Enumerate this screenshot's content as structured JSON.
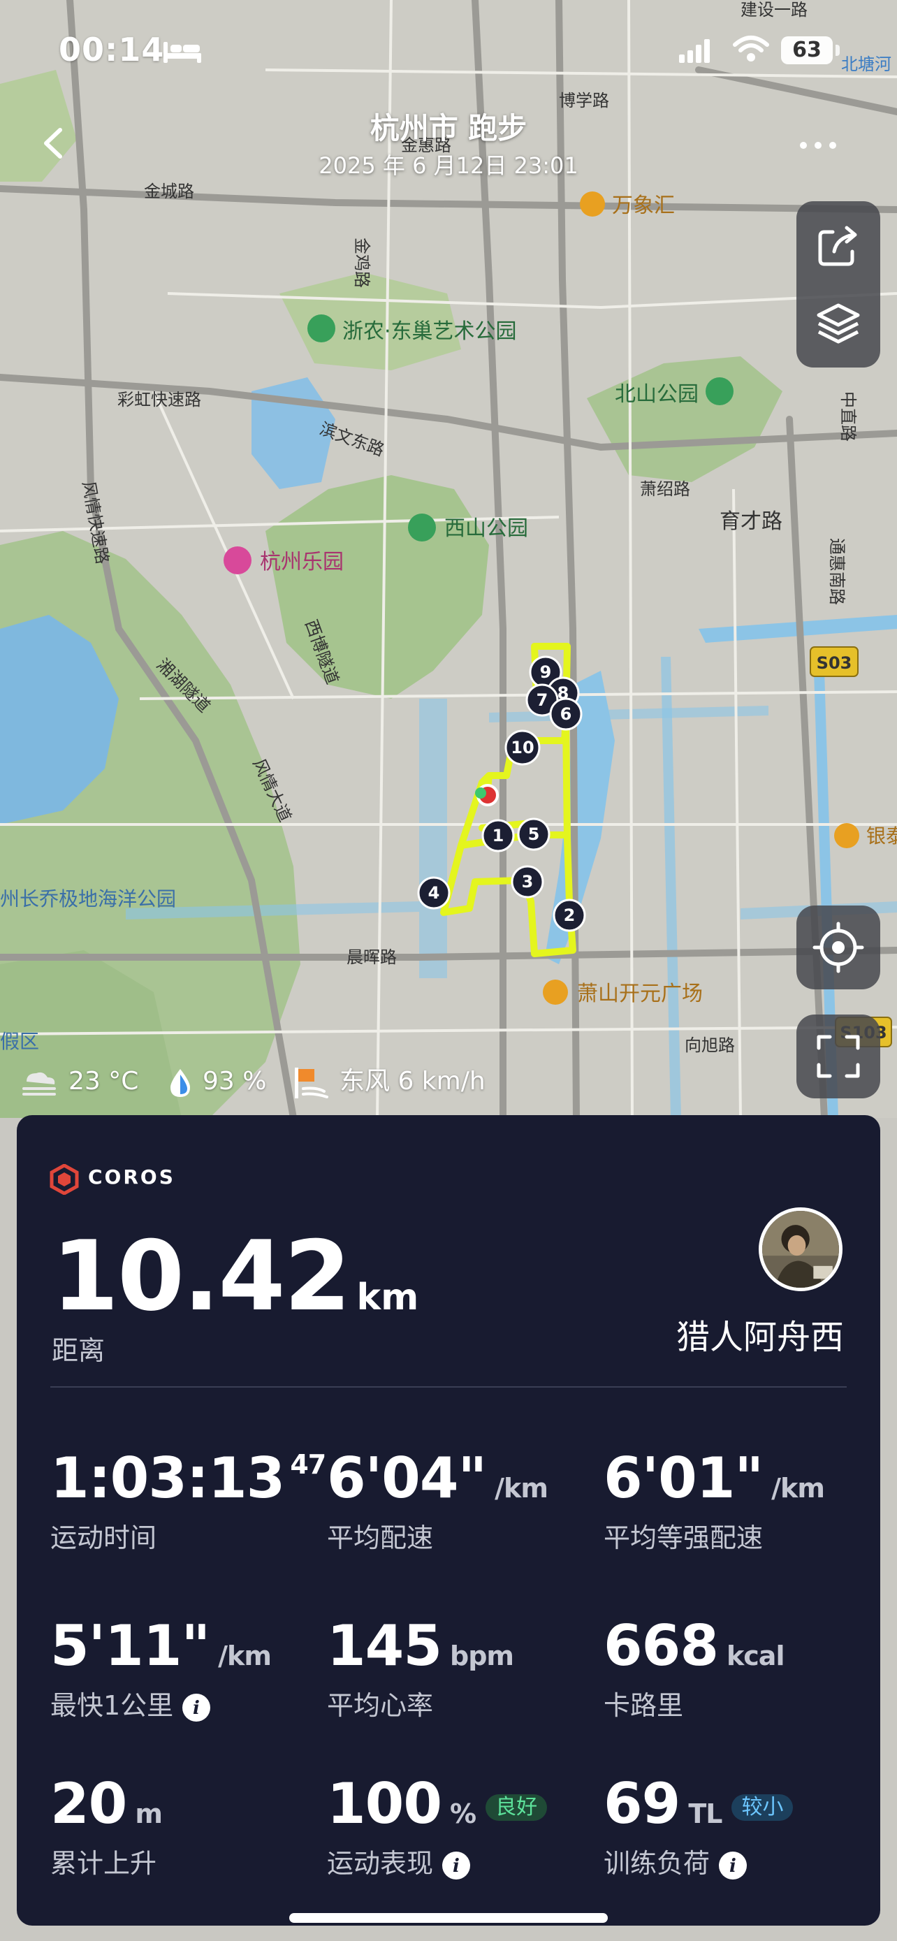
{
  "status_bar": {
    "time": "00:14",
    "battery": "63"
  },
  "header": {
    "title": "杭州市 跑步",
    "subtitle": "2025 年 6 月12日  23:01"
  },
  "map": {
    "labels": {
      "jianshe": "建设一路",
      "beigang": "北塘河",
      "boxue": "博学路",
      "jinhui": "金惠路",
      "jincheng": "金城路",
      "wanxianghui": "万象汇",
      "jinji": "金鸡路",
      "zhenong": "浙农·东巢艺术公园",
      "caihong": "彩虹快速路",
      "binwen": "滨文东路",
      "beishan": "北山公园",
      "xiaoshao": "萧绍路",
      "yucai": "育才路",
      "xishan": "西山公园",
      "hangzhouleyuan": "杭州乐园",
      "fengqing": "风情快速路",
      "xihong": "西博隧道",
      "xianghu": "湘湖隧道",
      "fengqingdadao": "风情大道",
      "tonghui": "通惠南路",
      "zhongzhi": "中直路",
      "s03": "S03",
      "yinsu": "银泰",
      "haiyang": "州长乔极地海洋公园",
      "chenhui": "晨晖路",
      "kaiyuan": "萧山开元广场",
      "xiangxu": "向旭路",
      "s103": "S103",
      "jiaqu": "假区",
      "xiangtang": "北塘"
    },
    "markers": [
      "1",
      "2",
      "3",
      "4",
      "5",
      "6",
      "7",
      "8",
      "9",
      "10"
    ]
  },
  "weather": {
    "temp": "23 °C",
    "humidity": "93 %",
    "wind": "东风 6 km/h"
  },
  "card": {
    "brand": "COROS",
    "distance_value": "10.42",
    "distance_unit": "km",
    "distance_label": "距离",
    "username": "猎人阿舟西",
    "stats": [
      {
        "value": "1:03:13",
        "sup": "47",
        "unit": "",
        "label": "运动时间"
      },
      {
        "value": "6'04\"",
        "unit": "/km",
        "label": "平均配速"
      },
      {
        "value": "6'01\"",
        "unit": "/km",
        "label": "平均等强配速"
      },
      {
        "value": "5'11\"",
        "unit": "/km",
        "label": "最快1公里"
      },
      {
        "value": "145",
        "unit": "bpm",
        "label": "平均心率"
      },
      {
        "value": "668",
        "unit": "kcal",
        "label": "卡路里"
      },
      {
        "value": "20",
        "unit": "m",
        "label": "累计上升"
      },
      {
        "value": "100",
        "unit": "%",
        "badge": "良好",
        "label": "运动表现"
      },
      {
        "value": "69",
        "unit": "TL",
        "badge": "较小",
        "label": "训练负荷"
      }
    ]
  },
  "colors": {
    "route": "#e4f51e",
    "card_bg": "#181b30",
    "good_badge": "#5de29b",
    "low_badge": "#6cc6ff"
  }
}
